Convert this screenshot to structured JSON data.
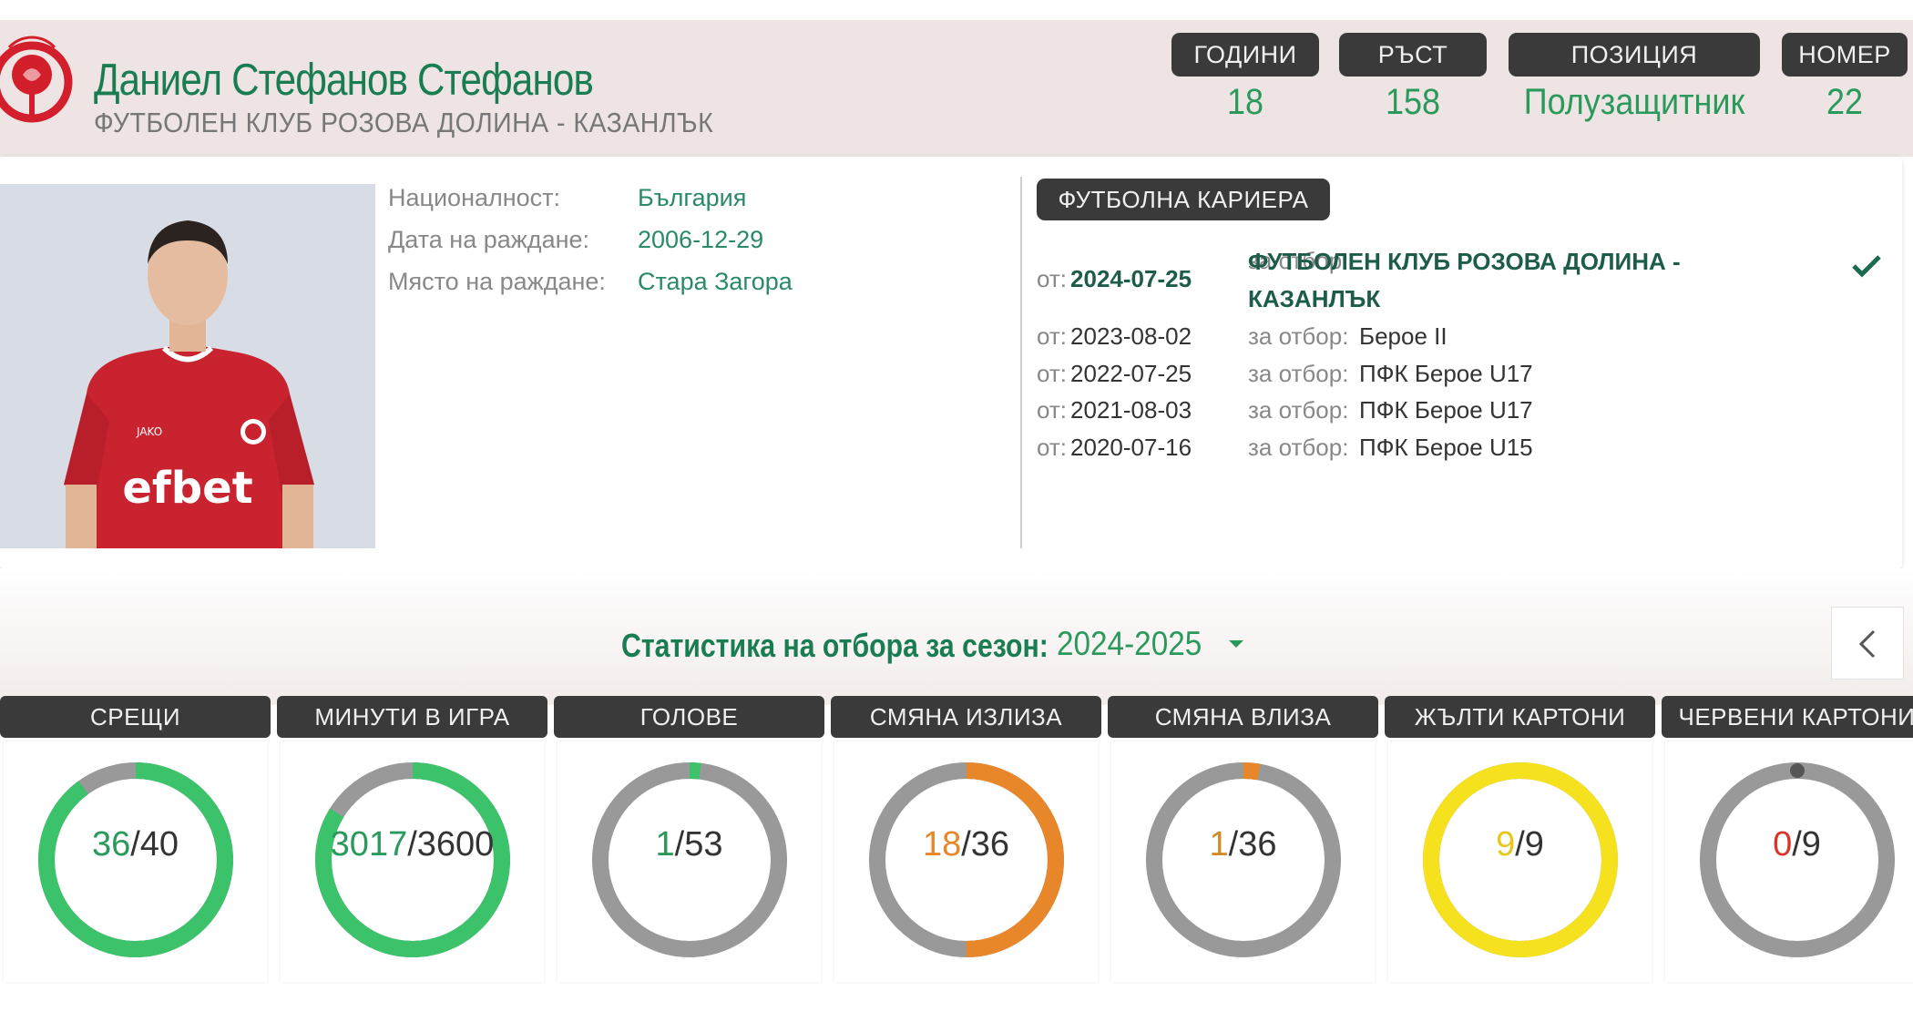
{
  "player": {
    "name": "Даниел Стефанов Стефанов",
    "club": "ФУТБОЛЕН КЛУБ РОЗОВА ДОЛИНА - КАЗАНЛЪК"
  },
  "header_stats": [
    {
      "label": "ГОДИНИ",
      "value": "18"
    },
    {
      "label": "РЪСТ",
      "value": "158"
    },
    {
      "label": "ПОЗИЦИЯ",
      "value": "Полузащитник"
    },
    {
      "label": "НОМЕР",
      "value": "22"
    }
  ],
  "details": {
    "nationality_label": "Националност:",
    "nationality": "България",
    "birthdate_label": "Дата на раждане:",
    "birthdate": "2006-12-29",
    "birthplace_label": "Място на раждане:",
    "birthplace": "Стара Загора"
  },
  "career": {
    "title": "ФУТБОЛНА КАРИЕРА",
    "from_label": "от:",
    "team_label": "за отбор:",
    "entries": [
      {
        "date": "2024-07-25",
        "team": "ФУТБОЛЕН КЛУБ РОЗОВА ДОЛИНА - КАЗАНЛЪК",
        "current": true
      },
      {
        "date": "2023-08-02",
        "team": "Берое II"
      },
      {
        "date": "2022-07-25",
        "team": "ПФК Берое U17"
      },
      {
        "date": "2021-08-03",
        "team": "ПФК Берое U17"
      },
      {
        "date": "2020-07-16",
        "team": "ПФК Берое U15"
      }
    ]
  },
  "season": {
    "title": "Статистика на отбора за сезон:",
    "selected": "2024-2025"
  },
  "stats": [
    {
      "label": "СРЕЩИ",
      "value": 36,
      "total": 40,
      "value_text": "36",
      "total_text": "/40",
      "color": "#3cc26a",
      "num_color": "#2a9a5c"
    },
    {
      "label": "МИНУТИ В ИГРА",
      "value": 3017,
      "total": 3600,
      "value_text": "3017",
      "total_text": "/3600",
      "color": "#3cc26a",
      "num_color": "#2a9a5c"
    },
    {
      "label": "ГОЛОВЕ",
      "value": 1,
      "total": 53,
      "value_text": "1",
      "total_text": "/53",
      "color": "#3cc26a",
      "num_color": "#2a9a5c"
    },
    {
      "label": "СМЯНА ИЗЛИЗА",
      "value": 18,
      "total": 36,
      "value_text": "18",
      "total_text": "/36",
      "color": "#e8862a",
      "num_color": "#e8862a"
    },
    {
      "label": "СМЯНА ВЛИЗА",
      "value": 1,
      "total": 36,
      "value_text": "1",
      "total_text": "/36",
      "color": "#e8862a",
      "num_color": "#d08a2a"
    },
    {
      "label": "ЖЪЛТИ КАРТОНИ",
      "value": 9,
      "total": 9,
      "value_text": "9",
      "total_text": "/9",
      "color": "#f6e11e",
      "num_color": "#e6c81a"
    },
    {
      "label": "ЧЕРВЕНИ КАРТОНИ",
      "value": 0,
      "total": 9,
      "value_text": "0",
      "total_text": "/9",
      "color": "#d9342b",
      "num_color": "#d9342b"
    }
  ],
  "colors": {
    "accent": "#1a7d52",
    "track": "#999999",
    "dark_badge": "#3a3a3a"
  }
}
